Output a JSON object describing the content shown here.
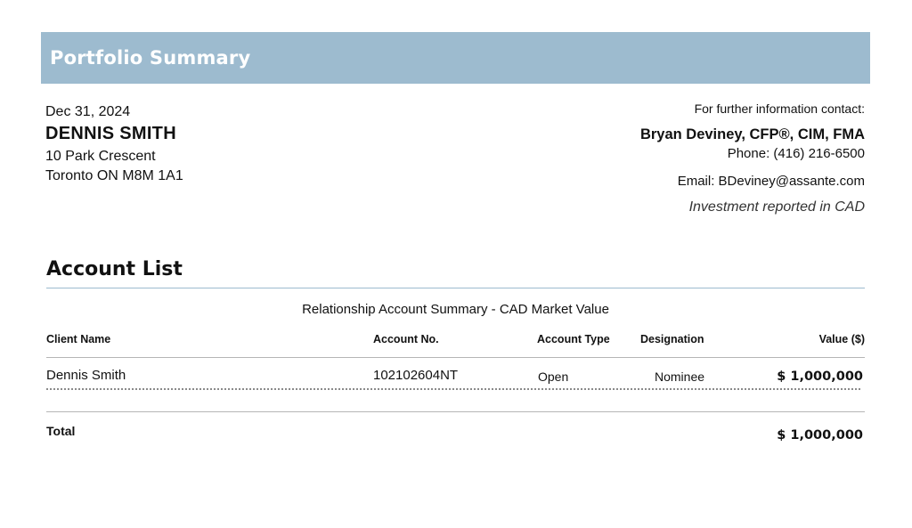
{
  "header": {
    "title": "Portfolio Summary"
  },
  "client": {
    "date": "Dec 31, 2024",
    "name": "DENNIS SMITH",
    "address_line1": "10 Park Crescent",
    "address_line2": "Toronto ON M8M 1A1"
  },
  "contact": {
    "label": "For further information contact:",
    "advisor": "Bryan Deviney, CFP®, CIM, FMA",
    "phone": "Phone: (416) 216-6500",
    "email": "Email: BDeviney@assante.com",
    "currency_note": "Investment reported in CAD"
  },
  "accounts": {
    "section_title": "Account List",
    "table_title": "Relationship Account Summary - CAD Market Value",
    "columns": [
      "Client Name",
      "Account No.",
      "Account Type",
      "Designation",
      "Value ($)"
    ],
    "rows": [
      {
        "client_name": "Dennis Smith",
        "account_no": "102102604NT",
        "account_type": "Open",
        "designation": "Nominee",
        "value": "$ 1,000,000"
      }
    ],
    "total_label": "Total",
    "total_value": "$ 1,000,000"
  },
  "colors": {
    "banner": "#9dbbcf"
  }
}
